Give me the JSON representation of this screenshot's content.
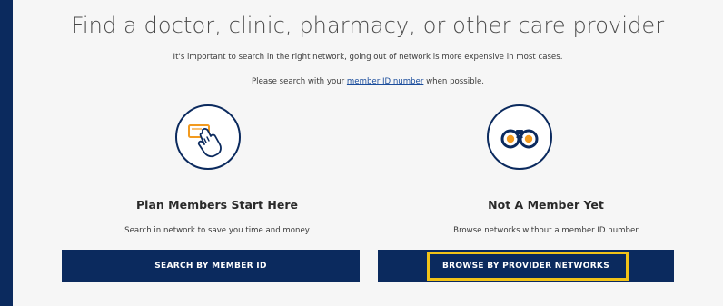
{
  "header": {
    "title": "Find a doctor, clinic, pharmacy, or other care provider",
    "subtitle": "It's important to search in the right network, going out of network is more expensive in most cases.",
    "hint_prefix": "Please search with your ",
    "hint_link": "member ID number",
    "hint_suffix": " when possible."
  },
  "members": {
    "icon": "hand-holding-card-icon",
    "heading": "Plan Members Start Here",
    "description": "Search in network to save you time and money",
    "button_label": "SEARCH BY MEMBER ID"
  },
  "non_members": {
    "icon": "binoculars-icon",
    "heading": "Not A Member Yet",
    "description": "Browse networks without a member ID number",
    "button_label": "BROWSE BY PROVIDER NETWORKS"
  },
  "colors": {
    "background_navy": "#0b2a5e",
    "panel": "#f6f6f6",
    "accent_orange": "#f29a1f",
    "focus_yellow": "#f2c318",
    "link_blue": "#1b4d9c"
  }
}
